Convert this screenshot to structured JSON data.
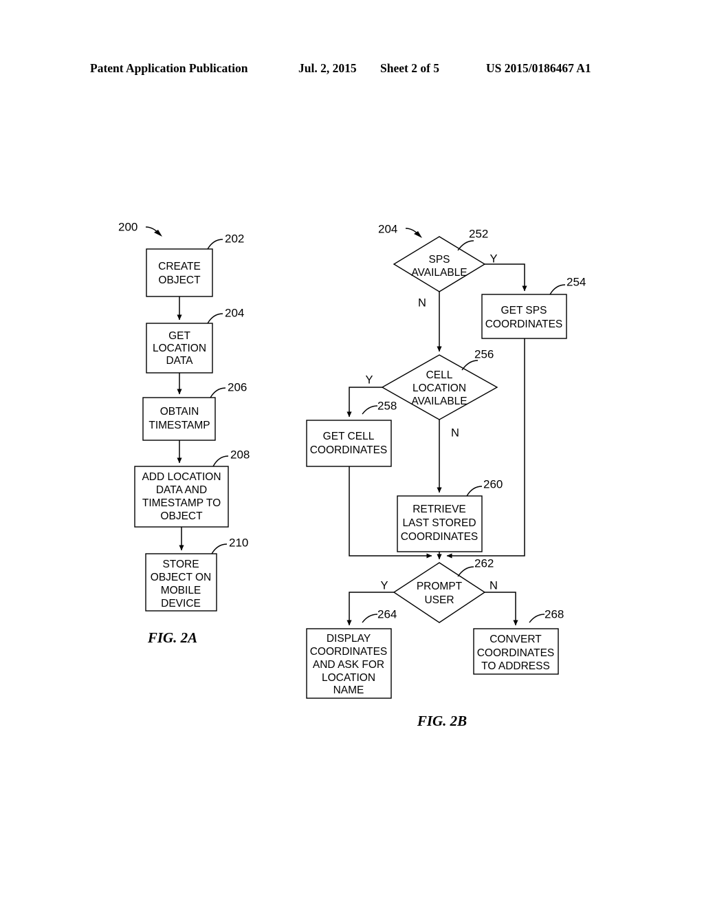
{
  "header": {
    "publication": "Patent Application Publication",
    "date": "Jul. 2, 2015",
    "sheet": "Sheet 2 of 5",
    "patent_number": "US 2015/0186467 A1"
  },
  "figures": [
    {
      "id": "fig-2a",
      "caption": "FIG. 2A",
      "flow_ref": "200",
      "nodes": [
        {
          "ref": "202",
          "type": "process",
          "label": "CREATE OBJECT"
        },
        {
          "ref": "204",
          "type": "process",
          "label": "GET LOCATION DATA"
        },
        {
          "ref": "206",
          "type": "process",
          "label": "OBTAIN TIMESTAMP"
        },
        {
          "ref": "208",
          "type": "process",
          "label": "ADD LOCATION DATA AND TIMESTAMP TO OBJECT"
        },
        {
          "ref": "210",
          "type": "process",
          "label": "STORE OBJECT ON MOBILE DEVICE"
        }
      ]
    },
    {
      "id": "fig-2b",
      "caption": "FIG. 2B",
      "flow_ref": "204",
      "nodes": [
        {
          "ref": "252",
          "type": "decision",
          "label": "SPS AVAILABLE",
          "yes": "Y",
          "no": "N"
        },
        {
          "ref": "254",
          "type": "process",
          "label": "GET SPS COORDINATES"
        },
        {
          "ref": "256",
          "type": "decision",
          "label": "CELL LOCATION AVAILABLE",
          "yes": "Y",
          "no": "N"
        },
        {
          "ref": "258",
          "type": "process",
          "label": "GET CELL COORDINATES"
        },
        {
          "ref": "260",
          "type": "process",
          "label": "RETRIEVE LAST STORED COORDINATES"
        },
        {
          "ref": "262",
          "type": "decision",
          "label": "PROMPT USER",
          "yes": "Y",
          "no": "N"
        },
        {
          "ref": "264",
          "type": "process",
          "label": "DISPLAY COORDINATES AND ASK FOR LOCATION NAME"
        },
        {
          "ref": "268",
          "type": "process",
          "label": "CONVERT COORDINATES TO ADDRESS"
        }
      ]
    }
  ],
  "fig2a": {
    "ref_200": "200",
    "ref_202": "202",
    "ref_204": "204",
    "ref_206": "206",
    "ref_208": "208",
    "ref_210": "210",
    "caption": "FIG. 2A",
    "node_202_line1": "CREATE",
    "node_202_line2": "OBJECT",
    "node_204_line1": "GET",
    "node_204_line2": "LOCATION",
    "node_204_line3": "DATA",
    "node_206_line1": "OBTAIN",
    "node_206_line2": "TIMESTAMP",
    "node_208_line1": "ADD LOCATION",
    "node_208_line2": "DATA AND",
    "node_208_line3": "TIMESTAMP TO",
    "node_208_line4": "OBJECT",
    "node_210_line1": "STORE",
    "node_210_line2": "OBJECT ON",
    "node_210_line3": "MOBILE",
    "node_210_line4": "DEVICE"
  },
  "fig2b": {
    "ref_204": "204",
    "ref_252": "252",
    "ref_254": "254",
    "ref_256": "256",
    "ref_258": "258",
    "ref_260": "260",
    "ref_262": "262",
    "ref_264": "264",
    "ref_268": "268",
    "caption": "FIG. 2B",
    "node_252_line1": "SPS",
    "node_252_line2": "AVAILABLE",
    "node_252_yes": "Y",
    "node_252_no": "N",
    "node_254_line1": "GET SPS",
    "node_254_line2": "COORDINATES",
    "node_256_line1": "CELL",
    "node_256_line2": "LOCATION",
    "node_256_line3": "AVAILABLE",
    "node_256_yes": "Y",
    "node_256_no": "N",
    "node_258_line1": "GET CELL",
    "node_258_line2": "COORDINATES",
    "node_260_line1": "RETRIEVE",
    "node_260_line2": "LAST STORED",
    "node_260_line3": "COORDINATES",
    "node_262_line1": "PROMPT",
    "node_262_line2": "USER",
    "node_262_yes": "Y",
    "node_262_no": "N",
    "node_264_line1": "DISPLAY",
    "node_264_line2": "COORDINATES",
    "node_264_line3": "AND ASK FOR",
    "node_264_line4": "LOCATION",
    "node_264_line5": "NAME",
    "node_268_line1": "CONVERT",
    "node_268_line2": "COORDINATES",
    "node_268_line3": "TO ADDRESS"
  }
}
